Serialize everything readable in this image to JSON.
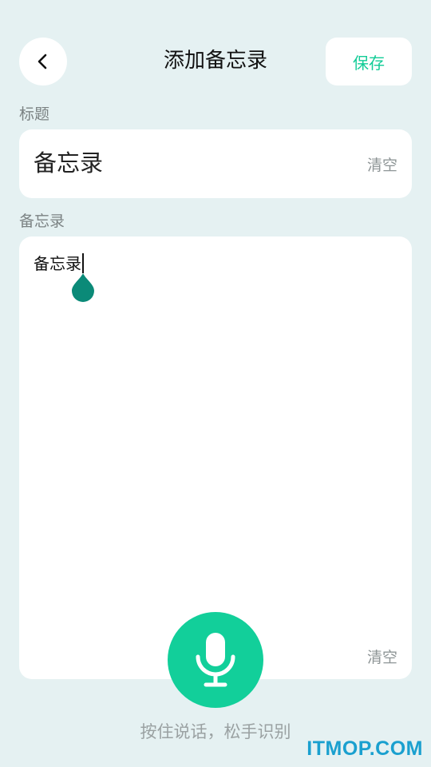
{
  "header": {
    "back_icon": "chevron-left-icon",
    "title": "添加备忘录",
    "save_label": "保存"
  },
  "title_section": {
    "label": "标题",
    "value": "备忘录",
    "clear_label": "清空"
  },
  "memo_section": {
    "label": "备忘录",
    "value": "备忘录",
    "clear_label": "清空"
  },
  "voice": {
    "mic_icon": "microphone-icon",
    "hint": "按住说话，松手识别"
  },
  "watermark": "ITMOP.COM",
  "colors": {
    "background": "#e5f1f2",
    "accent": "#12cf9a",
    "handle": "#0b8a78"
  }
}
